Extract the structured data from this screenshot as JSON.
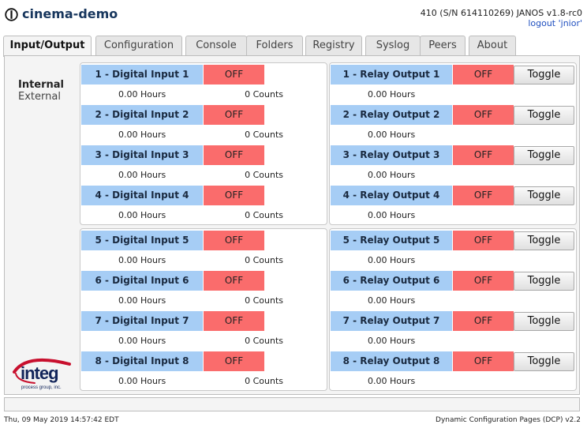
{
  "header": {
    "title": "cinema-demo",
    "serial": "410 (S/N 614110269) JANOS v1.8-rc0",
    "logout": "logout 'jnior'"
  },
  "tabs": [
    {
      "label": "Input/Output",
      "active": true
    },
    {
      "label": "Configuration",
      "active": false
    },
    {
      "label": "Console",
      "active": false
    },
    {
      "label": "Folders",
      "active": false
    },
    {
      "label": "Registry",
      "active": false
    },
    {
      "label": "Syslog",
      "active": false
    },
    {
      "label": "Peers",
      "active": false
    },
    {
      "label": "About",
      "active": false
    }
  ],
  "side": {
    "internal": "Internal",
    "external": "External"
  },
  "inputs": [
    {
      "label": "1 - Digital Input 1",
      "state": "OFF",
      "hours": "0.00 Hours",
      "counts": "0 Counts"
    },
    {
      "label": "2 - Digital Input 2",
      "state": "OFF",
      "hours": "0.00 Hours",
      "counts": "0 Counts"
    },
    {
      "label": "3 - Digital Input 3",
      "state": "OFF",
      "hours": "0.00 Hours",
      "counts": "0 Counts"
    },
    {
      "label": "4 - Digital Input 4",
      "state": "OFF",
      "hours": "0.00 Hours",
      "counts": "0 Counts"
    },
    {
      "label": "5 - Digital Input 5",
      "state": "OFF",
      "hours": "0.00 Hours",
      "counts": "0 Counts"
    },
    {
      "label": "6 - Digital Input 6",
      "state": "OFF",
      "hours": "0.00 Hours",
      "counts": "0 Counts"
    },
    {
      "label": "7 - Digital Input 7",
      "state": "OFF",
      "hours": "0.00 Hours",
      "counts": "0 Counts"
    },
    {
      "label": "8 - Digital Input 8",
      "state": "OFF",
      "hours": "0.00 Hours",
      "counts": "0 Counts"
    }
  ],
  "outputs": [
    {
      "label": "1 - Relay Output 1",
      "state": "OFF",
      "hours": "0.00 Hours",
      "toggle": "Toggle"
    },
    {
      "label": "2 - Relay Output 2",
      "state": "OFF",
      "hours": "0.00 Hours",
      "toggle": "Toggle"
    },
    {
      "label": "3 - Relay Output 3",
      "state": "OFF",
      "hours": "0.00 Hours",
      "toggle": "Toggle"
    },
    {
      "label": "4 - Relay Output 4",
      "state": "OFF",
      "hours": "0.00 Hours",
      "toggle": "Toggle"
    },
    {
      "label": "5 - Relay Output 5",
      "state": "OFF",
      "hours": "0.00 Hours",
      "toggle": "Toggle"
    },
    {
      "label": "6 - Relay Output 6",
      "state": "OFF",
      "hours": "0.00 Hours",
      "toggle": "Toggle"
    },
    {
      "label": "7 - Relay Output 7",
      "state": "OFF",
      "hours": "0.00 Hours",
      "toggle": "Toggle"
    },
    {
      "label": "8 - Relay Output 8",
      "state": "OFF",
      "hours": "0.00 Hours",
      "toggle": "Toggle"
    }
  ],
  "logo": {
    "main": "integ",
    "sub": "process group, inc.",
    "accent": "#c8102e",
    "text_color": "#12255a"
  },
  "colors": {
    "label_bg": "#a6cdf5",
    "off_bg": "#fa6c6c",
    "title": "#17365d",
    "link": "#1f4fbf"
  },
  "footer": {
    "datetime": "Thu, 09 May 2019 14:57:42 EDT",
    "version": "Dynamic Configuration Pages (DCP) v2.2"
  }
}
